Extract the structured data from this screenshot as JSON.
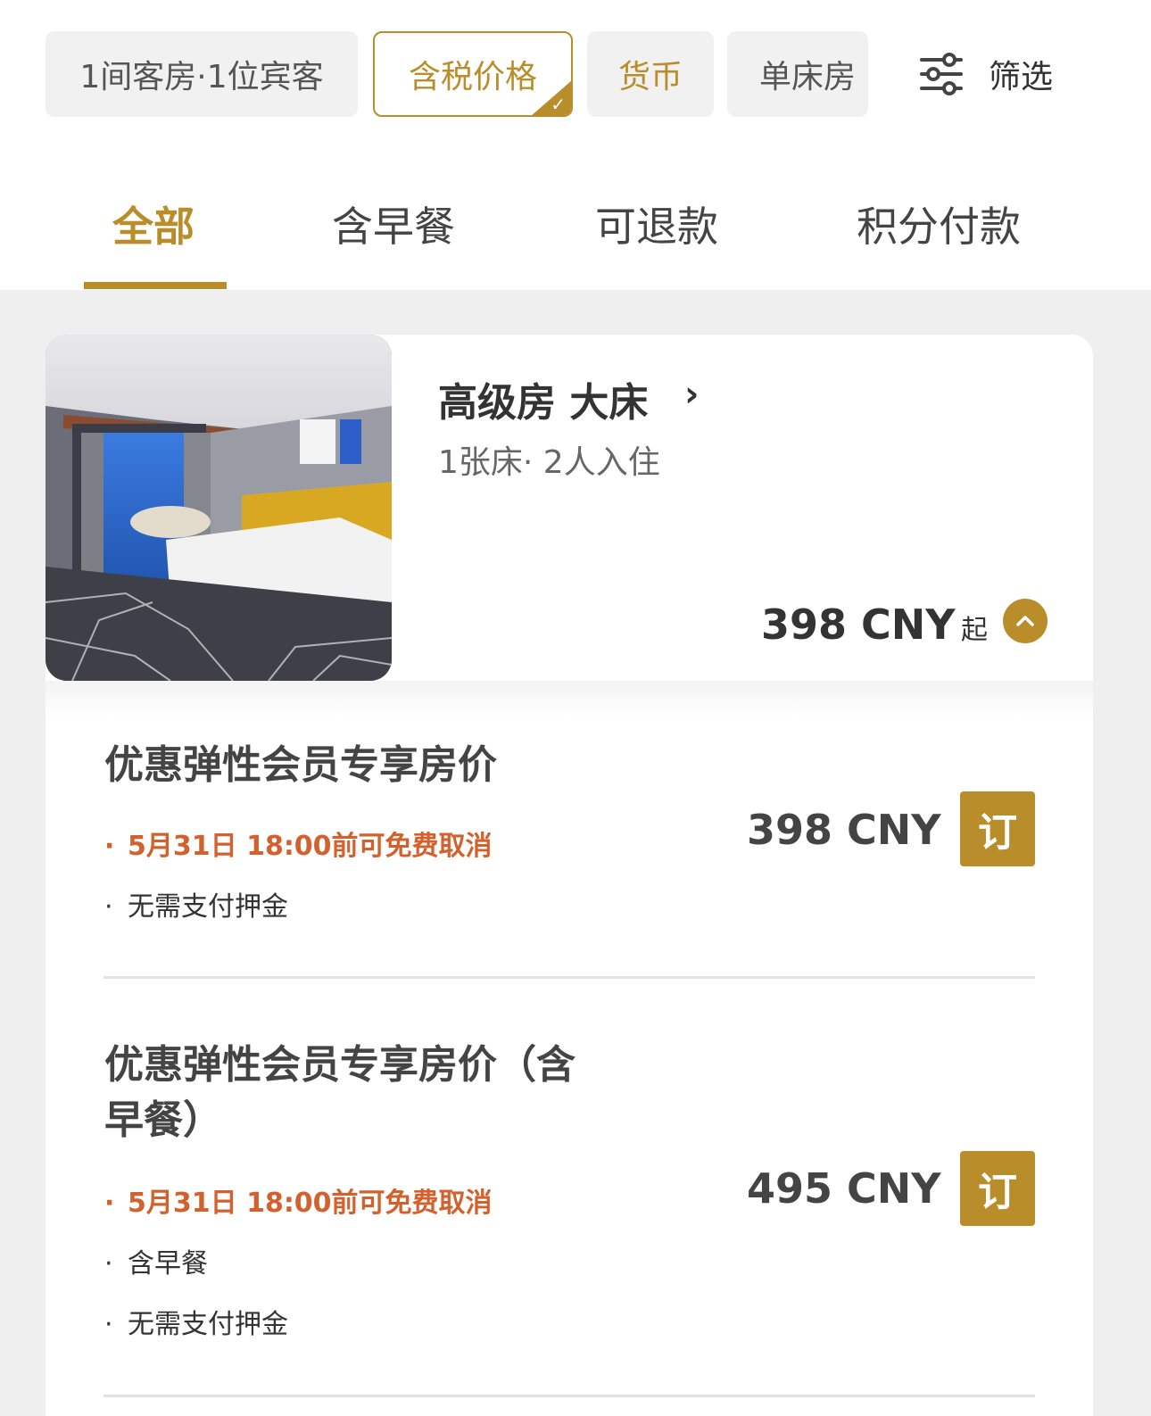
{
  "filters": {
    "rooms_guests": "1间客房·1位宾客",
    "tax_price": "含税价格",
    "currency": "货币",
    "bed_type": "单床房",
    "filter_label": "筛选"
  },
  "tabs": [
    {
      "label": "全部"
    },
    {
      "label": "含早餐"
    },
    {
      "label": "可退款"
    },
    {
      "label": "积分付款"
    }
  ],
  "room": {
    "name": "高级房 大床",
    "details": "1张床· 2人入住",
    "from_price": "398 CNY",
    "from_suffix": "起"
  },
  "rates": [
    {
      "name": "优惠弹性会员专享房价",
      "cancel": "5月31日 18:00前可免费取消",
      "notes": [
        "无需支付押金"
      ],
      "price": "398 CNY",
      "book_label": "订"
    },
    {
      "name_line1": "优惠弹性会员专享房价（含",
      "name_line2": "早餐）",
      "cancel": "5月31日 18:00前可免费取消",
      "notes": [
        "含早餐",
        "无需支付押金"
      ],
      "price": "495 CNY",
      "book_label": "订"
    }
  ],
  "colors": {
    "accent_gold": "#b88d2a",
    "cancel_orange": "#d2612e",
    "background_gray": "#efefef"
  },
  "icons": {
    "filter": "sliders-icon",
    "chevron": "chevron-right-icon",
    "collapse": "chevron-up-icon",
    "selected": "check-icon"
  }
}
